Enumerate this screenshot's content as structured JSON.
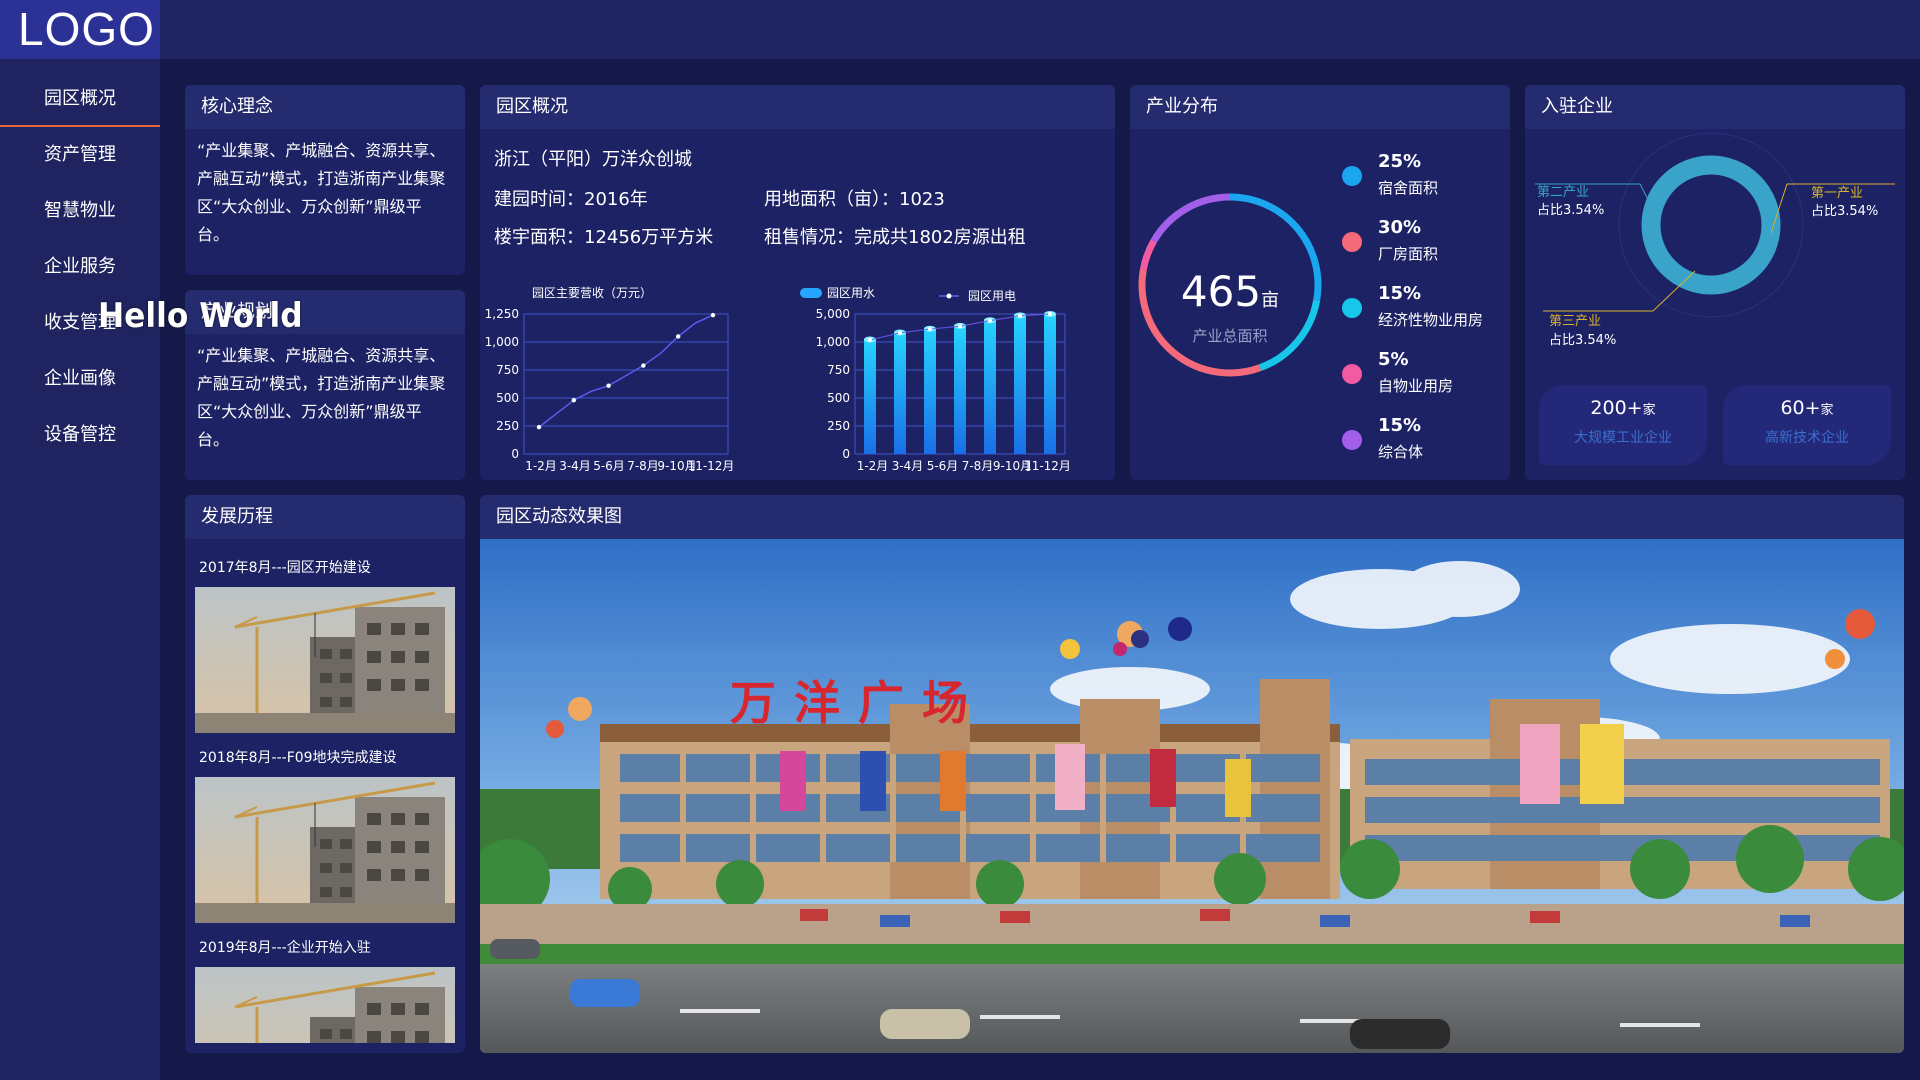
{
  "app": {
    "logo": "LOGO",
    "overlay_text": "Hello World"
  },
  "colors": {
    "accent": "#e3683d",
    "panel": "#1c2264",
    "panel_header": "#252b6f",
    "background": "#141949",
    "card_label": "#3b6fcf"
  },
  "sidebar": {
    "items": [
      {
        "label": "园区概况",
        "active": true
      },
      {
        "label": "资产管理"
      },
      {
        "label": "智慧物业"
      },
      {
        "label": "企业服务"
      },
      {
        "label": "收支管理"
      },
      {
        "label": "企业画像"
      },
      {
        "label": "设备管控"
      }
    ]
  },
  "core": {
    "title": "核心理念",
    "text": "“产业集聚、产城融合、资源共享、产融互动”模式，打造浙南产业集聚区“大众创业、万众创新”鼎级平台。"
  },
  "plan": {
    "title": "产业规划",
    "text": "“产业集聚、产城融合、资源共享、产融互动”模式，打造浙南产业集聚区“大众创业、万众创新”鼎级平台。"
  },
  "overview": {
    "title": "园区概况",
    "name": "浙江（平阳）万洋众创城",
    "build_time": "建园时间：2016年",
    "land_area": "用地面积（亩）：1023",
    "building_area": "楼宇面积：12456万平方米",
    "rent": "租售情况：完成共1802房源出租"
  },
  "chart_data": [
    {
      "type": "line",
      "title": "园区主要营收（万元）",
      "categories": [
        "1-2月",
        "3-4月",
        "5-6月",
        "7-8月",
        "9-10月",
        "11-12月"
      ],
      "x": [
        0,
        1,
        2,
        3,
        4,
        5,
        6,
        7,
        8,
        9,
        10
      ],
      "values": [
        240,
        360,
        480,
        560,
        610,
        700,
        790,
        900,
        1050,
        1170,
        1240
      ],
      "yticks": [
        0,
        250,
        500,
        750,
        1000,
        1250
      ],
      "ytick_labels": [
        "0",
        "250",
        "500",
        "750",
        "1,000",
        "1,250"
      ],
      "ylim": [
        0,
        1250
      ],
      "grid": true
    },
    {
      "type": "bar",
      "legend": [
        "园区用水",
        "园区用电"
      ],
      "legend_position": "top",
      "categories": [
        "1-2月",
        "3-4月",
        "5-6月",
        "7-8月",
        "9-10月",
        "11-12月"
      ],
      "series": [
        {
          "name": "园区用水",
          "values": [
            1350,
            2350,
            2900,
            3300,
            4100,
            4800,
            5150
          ]
        },
        {
          "name": "园区用电",
          "values": [
            1300,
            2300,
            2850,
            3250,
            4050,
            4750,
            5100
          ]
        }
      ],
      "yticks": [
        0,
        250,
        500,
        750,
        1000,
        5000
      ],
      "ytick_labels": [
        "0",
        "250",
        "500",
        "750",
        "1,000",
        "5,000"
      ],
      "grid": true
    },
    {
      "type": "pie",
      "title": "产业分布",
      "center_value": "465",
      "center_unit": "亩",
      "center_label": "产业总面积",
      "slices": [
        {
          "name": "宿舍面积",
          "label": "25%",
          "value": 25,
          "color": "#1ba6f0"
        },
        {
          "name": "厂房面积",
          "label": "30%",
          "value": 30,
          "color": "#f56a7a"
        },
        {
          "name": "经济性物业用房",
          "label": "15%",
          "value": 15,
          "color": "#17c6e8"
        },
        {
          "name": "自物业用房",
          "label": "5%",
          "value": 5,
          "color": "#f25ba2"
        },
        {
          "name": "综合体",
          "label": "15%",
          "value": 15,
          "color": "#a260ea"
        }
      ]
    },
    {
      "type": "pie",
      "title": "入驻企业",
      "slices": [
        {
          "name": "第一产业",
          "label": "占比3.54%",
          "value": 3.54
        },
        {
          "name": "第二产业",
          "label": "占比3.54%",
          "value": 3.54
        },
        {
          "name": "第三产业",
          "label": "占比3.54%",
          "value": 3.54
        }
      ]
    }
  ],
  "industry": {
    "title": "产业分布",
    "center_value": "465",
    "center_unit": "亩",
    "center_label": "产业总面积",
    "items": [
      {
        "pct": "25%",
        "label": "宿舍面积",
        "color": "#1ba6f0"
      },
      {
        "pct": "30%",
        "label": "厂房面积",
        "color": "#f56a7a"
      },
      {
        "pct": "15%",
        "label": "经济性物业用房",
        "color": "#17c6e8"
      },
      {
        "pct": "5%",
        "label": "自物业用房",
        "color": "#f25ba2"
      },
      {
        "pct": "15%",
        "label": "综合体",
        "color": "#a260ea"
      }
    ]
  },
  "enterprise": {
    "title": "入驻企业",
    "first": {
      "name": "第一产业",
      "pct": "占比3.54%"
    },
    "second": {
      "name": "第二产业",
      "pct": "占比3.54%"
    },
    "third": {
      "name": "第三产业",
      "pct": "占比3.54%"
    },
    "cards": [
      {
        "value": "200+",
        "unit": "家",
        "label": "大规模工业企业"
      },
      {
        "value": "60+",
        "unit": "家",
        "label": "高新技术企业"
      }
    ]
  },
  "history": {
    "title": "发展历程",
    "items": [
      {
        "date": "2017年8月---园区开始建设"
      },
      {
        "date": "2018年8月---F09地块完成建设"
      },
      {
        "date": "2019年8月---企业开始入驻"
      }
    ]
  },
  "dynamic": {
    "title": "园区动态效果图",
    "sign": "万洋广场"
  },
  "labels": {
    "line_chart_title": "园区主要营收（万元）",
    "water": "园区用水",
    "power": "园区用电"
  }
}
